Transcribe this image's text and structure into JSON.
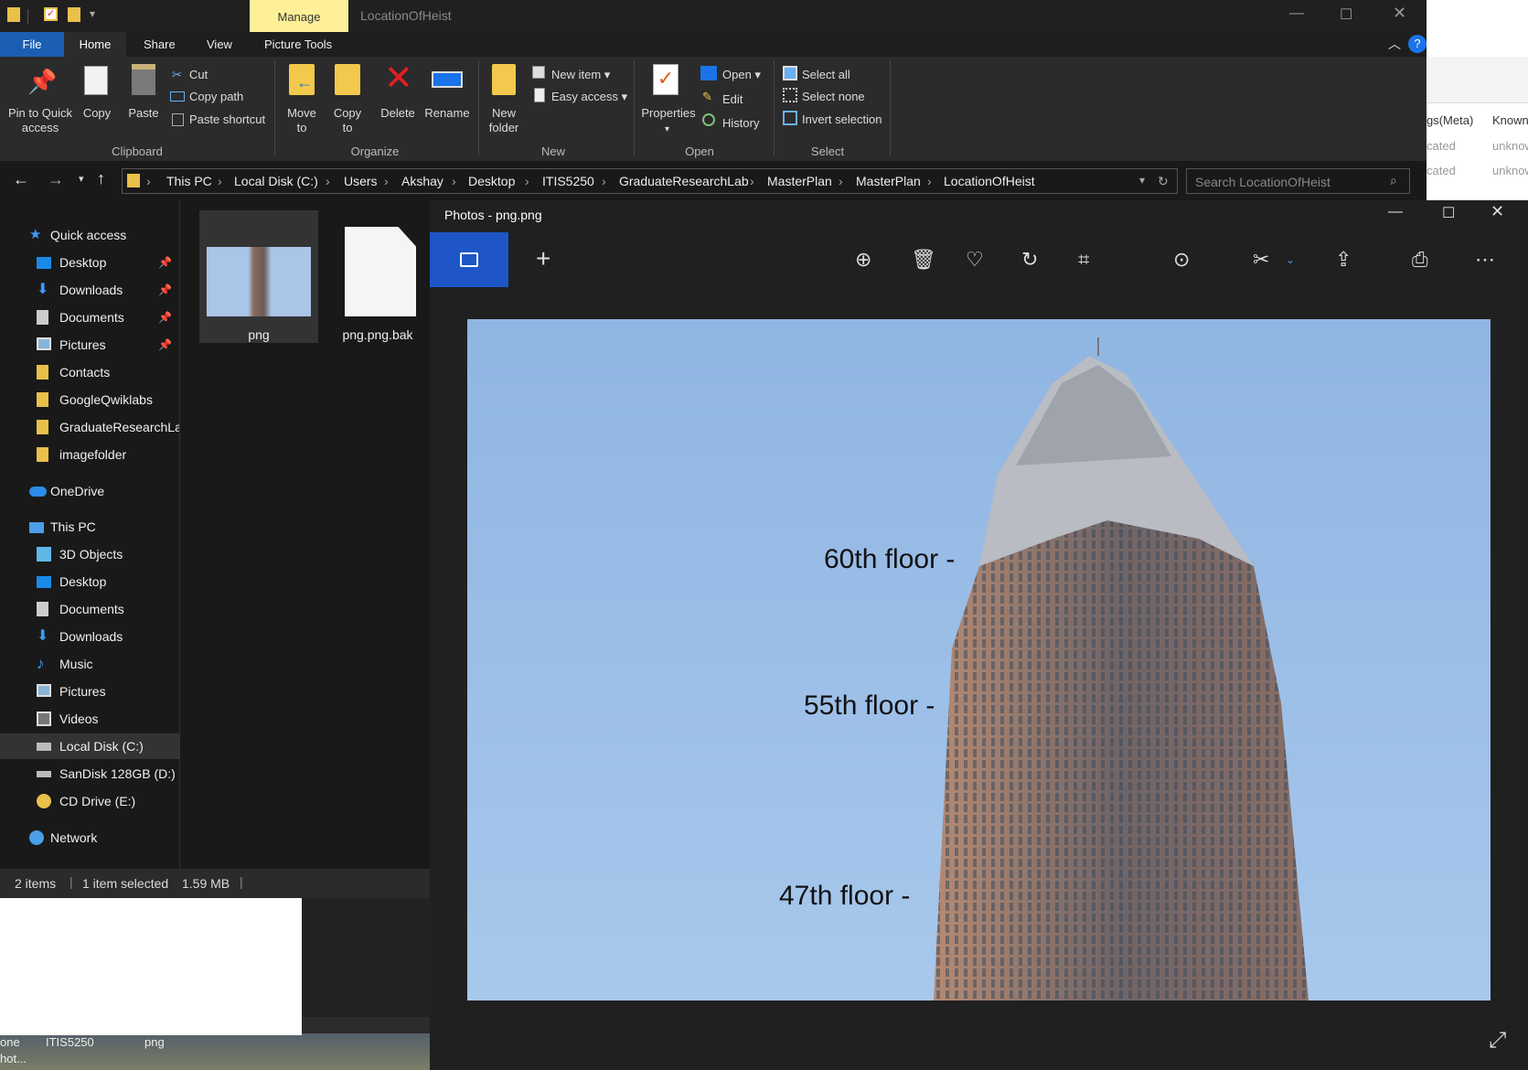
{
  "window": {
    "title": "LocationOfHeist",
    "manage_tab": "Manage"
  },
  "tabs": {
    "file": "File",
    "home": "Home",
    "share": "Share",
    "view": "View",
    "picture_tools": "Picture Tools"
  },
  "ribbon": {
    "pin": "Pin to Quick access",
    "copy": "Copy",
    "paste": "Paste",
    "cut": "Cut",
    "copy_path": "Copy path",
    "paste_shortcut": "Paste shortcut",
    "clipboard": "Clipboard",
    "move_to": "Move to",
    "copy_to": "Copy to",
    "delete": "Delete",
    "rename": "Rename",
    "organize": "Organize",
    "new_folder": "New folder",
    "new_item": "New item",
    "easy_access": "Easy access",
    "new": "New",
    "properties": "Properties",
    "open_btn": "Open",
    "edit": "Edit",
    "history": "History",
    "open": "Open",
    "select_all": "Select all",
    "select_none": "Select none",
    "invert_selection": "Invert selection",
    "select": "Select"
  },
  "breadcrumb": [
    "This PC",
    "Local Disk (C:)",
    "Users",
    "Akshay",
    "Desktop",
    "ITIS5250",
    "GraduateResearchLab",
    "MasterPlan",
    "MasterPlan",
    "LocationOfHeist"
  ],
  "search": {
    "placeholder": "Search LocationOfHeist"
  },
  "nav": {
    "quick_access": "Quick access",
    "qa_items": [
      "Desktop",
      "Downloads",
      "Documents",
      "Pictures",
      "Contacts",
      "GoogleQwiklabs",
      "GraduateResearchLab",
      "imagefolder"
    ],
    "onedrive": "OneDrive",
    "this_pc": "This PC",
    "pc_items": [
      "3D Objects",
      "Desktop",
      "Documents",
      "Downloads",
      "Music",
      "Pictures",
      "Videos",
      "Local Disk (C:)",
      "SanDisk 128GB (D:)",
      "CD Drive (E:)"
    ],
    "network": "Network"
  },
  "files": [
    {
      "name": "png"
    },
    {
      "name": "png.png.bak"
    }
  ],
  "status": {
    "items": "2 items",
    "selected": "1 item selected",
    "size": "1.59 MB"
  },
  "photos": {
    "title": "Photos - png.png",
    "labels": [
      "60th floor -",
      "55th floor -",
      "47th floor -"
    ]
  },
  "bg": {
    "col1": "gs(Meta)",
    "col2": "Known",
    "cell1": "cated",
    "cell2": "unknow",
    "desk1": "one",
    "desk1b": "hot...",
    "desk2": "ITIS5250",
    "desk3": "png"
  },
  "colors": {
    "accent": "#1a5fb4",
    "manage": "#fdf099",
    "viewbtn": "#1e56c8"
  }
}
